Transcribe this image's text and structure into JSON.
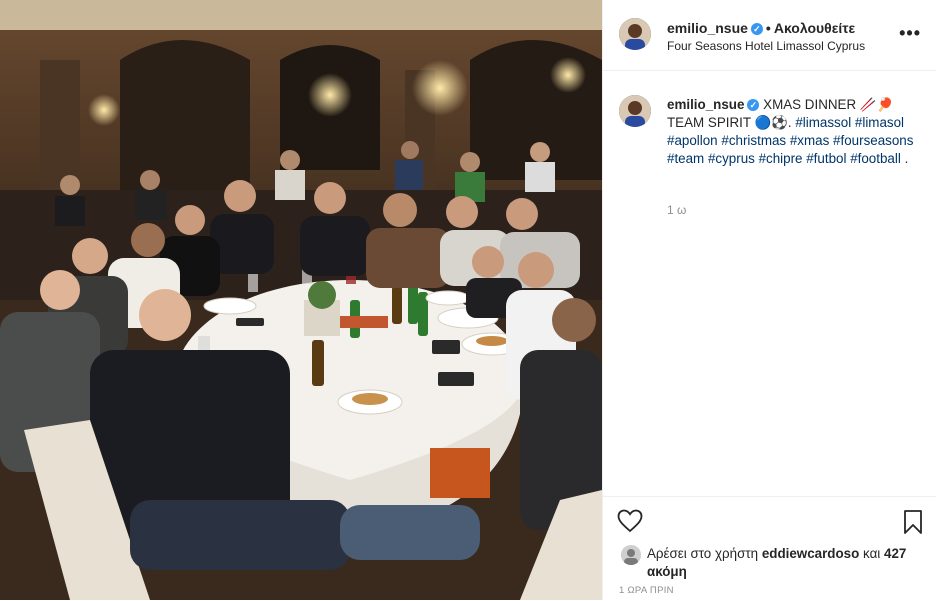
{
  "post": {
    "username": "emilio_nsue",
    "follow_state": "Ακολουθείτε",
    "location": "Four Seasons Hotel Limassol Cyprus",
    "more_label": "•••"
  },
  "caption": {
    "username": "emilio_nsue",
    "text": "XMAS DINNER 🥢🏓 TEAM SPIRIT 🔵⚽.",
    "hashtags": [
      "#limassol",
      "#limasol",
      "#apollon",
      "#christmas",
      "#xmas",
      "#fourseasons",
      "#team",
      "#cyprus",
      "#chipre",
      "#futbol",
      "#football"
    ],
    "trailing": ".",
    "time_ago": "1 ω"
  },
  "likes": {
    "prefix": "Αρέσει στο χρήστη",
    "liker": "eddiewcardoso",
    "conjunction": "και",
    "others": "427 ακόμη"
  },
  "posted_label": "1 ΩΡΑ ΠΡΙΝ",
  "icons": {
    "like": "heart-icon",
    "save": "bookmark-icon",
    "verified": "verified-badge-icon",
    "more": "more-options-icon"
  },
  "colors": {
    "hashtag": "#003569",
    "verified": "#3897f0",
    "muted": "#8e8e8e"
  }
}
